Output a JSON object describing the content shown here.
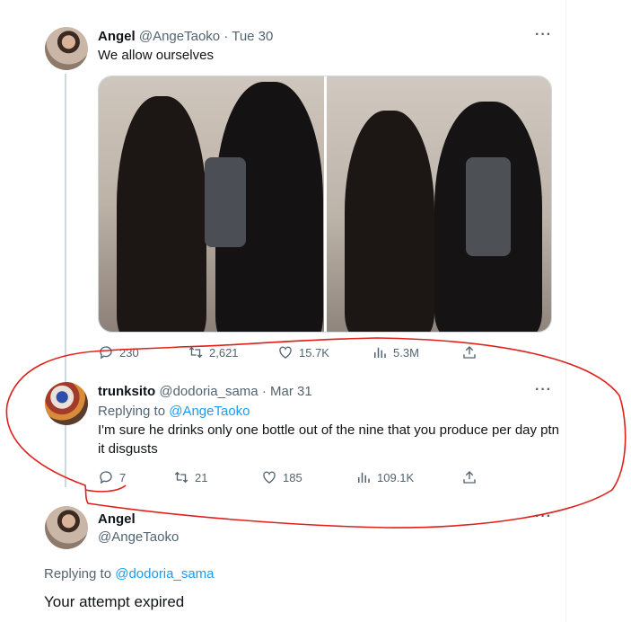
{
  "tweet1": {
    "display_name": "Angel",
    "handle": "@AngeTaoko",
    "separator": "·",
    "date": "Tue 30",
    "text": "We allow ourselves",
    "more": "···",
    "stats": {
      "replies": "230",
      "retweets": "2,621",
      "likes": "15.7K",
      "views": "5.3M"
    }
  },
  "tweet2": {
    "display_name": "trunksito",
    "handle": "@dodoria_sama",
    "separator": "·",
    "date": "Mar 31",
    "replying_prefix": "Replying to ",
    "replying_to": "@AngeTaoko",
    "text": "I'm sure he drinks only one bottle out of the nine that you produce per day ptn it disgusts",
    "more": "···",
    "stats": {
      "replies": "7",
      "retweets": "21",
      "likes": "185",
      "views": "109.1K"
    }
  },
  "tweet3": {
    "display_name": "Angel",
    "handle": "@AngeTaoko",
    "replying_prefix": "Replying to ",
    "replying_to": "@dodoria_sama",
    "text": "Your attempt expired",
    "more": "···"
  },
  "icons": [
    "reply-icon",
    "retweet-icon",
    "like-icon",
    "views-icon",
    "share-icon",
    "more-icon"
  ],
  "colors": {
    "link": "#1d9bf0",
    "muted": "#536471",
    "annotation": "#e0201a"
  }
}
